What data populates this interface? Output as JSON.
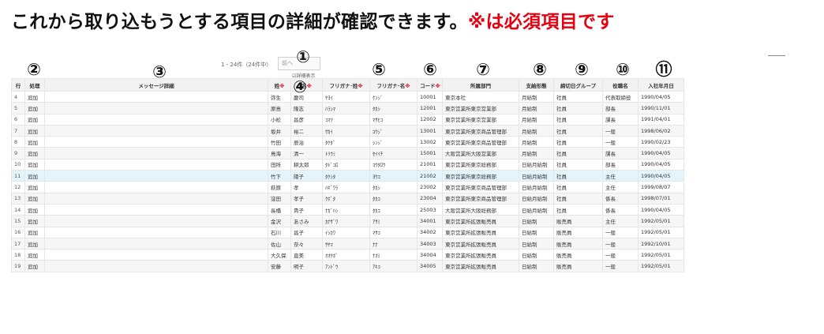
{
  "heading": {
    "main": "これから取り込もうとする項目の詳細が確認できます。",
    "required_note": "※は必須項目です",
    "required_color": "#e60012"
  },
  "pager": {
    "range_text": "1 - 24件（24件中）",
    "button_label": "前へ",
    "checkbox_label": "☑詳細表示"
  },
  "markers": [
    "①",
    "②",
    "③",
    "④",
    "⑤",
    "⑥",
    "⑦",
    "⑧",
    "⑨",
    "⑩",
    "⑪"
  ],
  "table": {
    "columns": [
      {
        "label": "行",
        "req": ""
      },
      {
        "label": "処理",
        "req": ""
      },
      {
        "label": "メッセージ詳細",
        "req": ""
      },
      {
        "label": "姓",
        "req": "※"
      },
      {
        "label": "名",
        "req": "※"
      },
      {
        "label": "フリガナ･姓",
        "req": "※"
      },
      {
        "label": "フリガナ･名",
        "req": "※"
      },
      {
        "label": "コード",
        "req": "※"
      },
      {
        "label": "所属部門",
        "req": ""
      },
      {
        "label": "支給形態",
        "req": ""
      },
      {
        "label": "締切日グループ",
        "req": ""
      },
      {
        "label": "役職名",
        "req": ""
      },
      {
        "label": "入社年月日",
        "req": ""
      }
    ],
    "highlight_row": 7,
    "rows": [
      [
        "4",
        "追加",
        "",
        "弥生",
        "慶司",
        "ﾔﾖｲ",
        "ｹﾝｼﾞ",
        "10001",
        "東京本社",
        "月給制",
        "社員",
        "代表取締役",
        "1990/04/05"
      ],
      [
        "5",
        "追加",
        "",
        "原島",
        "隆志",
        "ﾊﾗｼﾏ",
        "ﾀｶｼ",
        "12001",
        "東京営業所東京営業部",
        "月給制",
        "社員",
        "部長",
        "1990/11/01"
      ],
      [
        "6",
        "追加",
        "",
        "小松",
        "昌彦",
        "ｺﾏﾂ",
        "ﾏｻﾋｺ",
        "12002",
        "東京営業所東京営業部",
        "月給制",
        "社員",
        "課長",
        "1991/04/01"
      ],
      [
        "7",
        "追加",
        "",
        "坂井",
        "裕二",
        "ｻｶｲ",
        "ﾕｳｼﾞ",
        "13001",
        "東京営業所東京商品管理部",
        "月給制",
        "社員",
        "一般",
        "1998/06/02"
      ],
      [
        "8",
        "追加",
        "",
        "竹田",
        "辰治",
        "ﾀｹﾀﾞ",
        "ｼﾝｼﾞ",
        "13002",
        "東京営業所東京商品管理部",
        "月給制",
        "社員",
        "一般",
        "1990/02/23"
      ],
      [
        "9",
        "追加",
        "",
        "鳥海",
        "清一",
        "ﾄﾘｳﾐ",
        "ｾｲｲﾁ",
        "15001",
        "大阪営業所大阪営業部",
        "月給制",
        "社員",
        "課長",
        "1990/04/05"
      ],
      [
        "10",
        "追加",
        "",
        "田所",
        "耕太郎",
        "ﾀﾄﾞｺﾛ",
        "ｺｳﾀﾛｳ",
        "21001",
        "東京営業所東京総務部",
        "日給月給制",
        "社員",
        "部長",
        "1990/04/05"
      ],
      [
        "11",
        "追加",
        "",
        "竹下",
        "陽子",
        "ﾀｹｼﾀ",
        "ﾖｳｺ",
        "21002",
        "東京営業所東京総務部",
        "日給月給制",
        "社員",
        "主任",
        "1990/04/05"
      ],
      [
        "12",
        "追加",
        "",
        "萩原",
        "孝",
        "ﾊｷﾞﾜﾗ",
        "ﾀｶｼ",
        "23002",
        "東京営業所東京商品管理部",
        "日給月給制",
        "社員",
        "主任",
        "1999/08/07"
      ],
      [
        "13",
        "追加",
        "",
        "窪田",
        "孝子",
        "ｸﾎﾞﾀ",
        "ﾀｶｺ",
        "23004",
        "東京営業所東京商品管理部",
        "日給月給制",
        "社員",
        "係長",
        "1998/07/01"
      ],
      [
        "14",
        "追加",
        "",
        "長橋",
        "貴子",
        "ﾅｶﾞﾊｼ",
        "ﾀｶｺ",
        "25003",
        "大阪営業所大阪総務部",
        "日給月給制",
        "社員",
        "係長",
        "1990/04/05"
      ],
      [
        "15",
        "追加",
        "",
        "金沢",
        "あさみ",
        "ｶﾅｻﾞﾜ",
        "ｱｻﾐ",
        "34001",
        "東京営業所拡張販売員",
        "日給制",
        "販売員",
        "主任",
        "1992/05/01"
      ],
      [
        "16",
        "追加",
        "",
        "石川",
        "昌子",
        "ｲｼｶﾜ",
        "ﾏｻｺ",
        "34002",
        "東京営業所拡張販売員",
        "日給制",
        "販売員",
        "一般",
        "1992/05/01"
      ],
      [
        "17",
        "追加",
        "",
        "佐山",
        "奈々",
        "ｻﾔﾏ",
        "ﾅﾅ",
        "34003",
        "東京営業所拡張販売員",
        "日給制",
        "販売員",
        "一般",
        "1992/10/01"
      ],
      [
        "18",
        "追加",
        "",
        "大久保",
        "直美",
        "ｵｵｸﾎﾞ",
        "ﾅｵﾐ",
        "34004",
        "東京営業所拡張販売員",
        "日給制",
        "販売員",
        "一般",
        "1992/05/01"
      ],
      [
        "19",
        "追加",
        "",
        "安藤",
        "明子",
        "ｱﾝﾄﾞｳ",
        "ｱｷｺ",
        "34005",
        "東京営業所拡張販売員",
        "日給制",
        "販売員",
        "一般",
        "1992/05/01"
      ]
    ]
  }
}
